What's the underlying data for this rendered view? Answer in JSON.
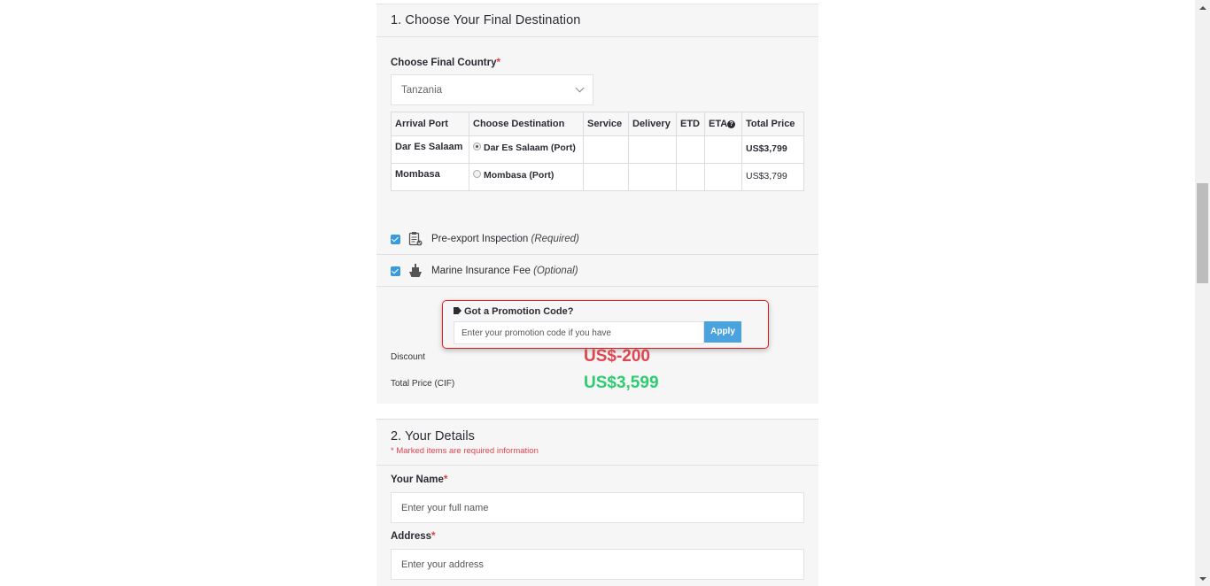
{
  "section1": {
    "title": "1. Choose Your Final Destination",
    "country_label": "Choose Final Country",
    "required_mark": "*",
    "country_value": "Tanzania",
    "table": {
      "headers": [
        "Arrival Port",
        "Choose Destination",
        "Service",
        "Delivery",
        "ETD",
        "ETA",
        "Total Price"
      ],
      "rows": [
        {
          "port": "Dar Es Salaam",
          "destination": "Dar Es Salaam (Port)",
          "selected": true,
          "service": "",
          "delivery": "",
          "etd": "",
          "eta": "",
          "price": "US$3,799"
        },
        {
          "port": "Mombasa",
          "destination": "Mombasa (Port)",
          "selected": false,
          "service": "",
          "delivery": "",
          "etd": "",
          "eta": "",
          "price": "US$3,799"
        }
      ]
    },
    "options": [
      {
        "label": "Pre-export Inspection",
        "note": "(Required)",
        "checked": true,
        "icon": "clipboard-check-icon"
      },
      {
        "label": "Marine Insurance Fee",
        "note": "(Optional)",
        "checked": true,
        "icon": "ship-icon"
      }
    ],
    "promo": {
      "title": "Got a Promotion Code?",
      "placeholder": "Enter your promotion code if you have",
      "apply_label": "Apply"
    },
    "summary": {
      "discount_label": "Discount",
      "discount_value": "US$-200",
      "total_label": "Total Price (CIF)",
      "total_value": "US$3,599"
    }
  },
  "section2": {
    "title": "2. Your Details",
    "subtitle": "* Marked items are required information",
    "name_label": "Your Name",
    "name_placeholder": "Enter your full name",
    "address_label": "Address",
    "address_placeholder": "Enter your address"
  },
  "colors": {
    "accent_blue": "#4aa3df",
    "price_green": "#2ecc71",
    "discount_red": "#e0454f",
    "highlight_red": "#e21b1b"
  }
}
